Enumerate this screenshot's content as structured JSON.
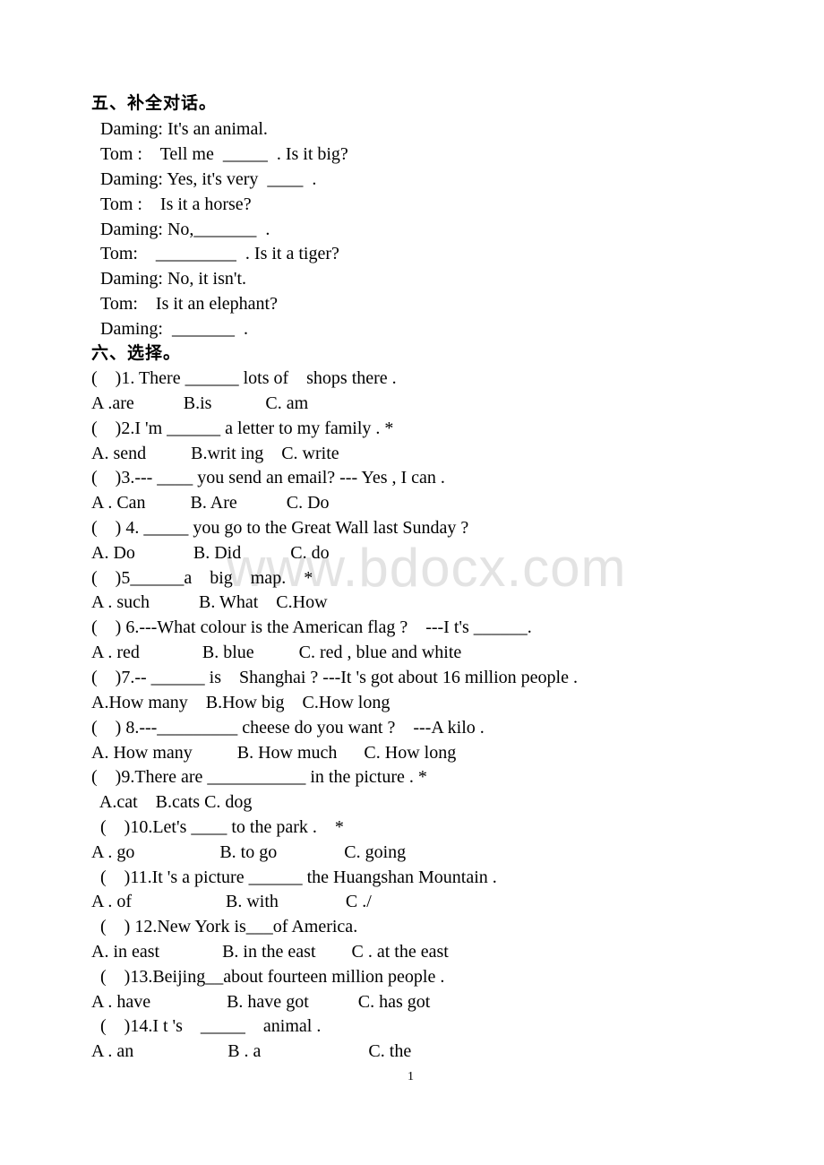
{
  "watermark": "www.bdocx.com",
  "page_number": "1",
  "section5": {
    "heading": "五、补全对话。",
    "lines": [
      "Daming: It's an animal.",
      "Tom :    Tell me  _____  . Is it big?",
      "Daming: Yes, it's very  ____  .",
      "Tom :    Is it a horse?",
      "Daming: No,_______  .",
      "Tom:    _________  . Is it a tiger?",
      "Daming: No, it isn't.",
      "Tom:    Is it an elephant?",
      "Daming:  _______  ."
    ]
  },
  "section6": {
    "heading": "六、选择。",
    "questions": [
      {
        "stem": "(    )1. There ______ lots of    shops there .",
        "options": "A .are           B.is            C. am"
      },
      {
        "stem": "(    )2.I 'm ______ a letter to my family . *",
        "options": "A. send          B.writ ing    C. write"
      },
      {
        "stem": "(    )3.--- ____ you send an email? --- Yes , I can .",
        "options": "A . Can          B. Are           C. Do"
      },
      {
        "stem": "(    ) 4. _____ you go to the Great Wall last Sunday ?",
        "options": "A. Do             B. Did           C. do"
      },
      {
        "stem": "(    )5______a    big    map.    *",
        "options": "A . such           B. What    C.How"
      },
      {
        "stem": "(    ) 6.---What colour is the American flag ?    ---I t's ______.",
        "options": "A . red              B. blue          C. red , blue and white"
      },
      {
        "stem": "(    )7.-- ______ is    Shanghai ? ---It 's got about 16 million people .",
        "options": "A.How many    B.How big    C.How long"
      },
      {
        "stem": "(    ) 8.---_________ cheese do you want ?    ---A kilo .",
        "options": "A. How many          B. How much      C. How long"
      },
      {
        "stem": "(    )9.There are ___________ in the picture . *",
        "options": "  A.cat    B.cats C. dog"
      },
      {
        "stem": "  (    )10.Let's ____ to the park .    *",
        "options": "A . go                   B. to go               C. going"
      },
      {
        "stem": "  (    )11.It 's a picture ______ the Huangshan Mountain .",
        "options": "A . of                     B. with               C ./"
      },
      {
        "stem": "  (    ) 12.New York is___of America.",
        "options": "A. in east              B. in the east        C . at the east"
      },
      {
        "stem": "  (    )13.Beijing__about fourteen million people .",
        "options": "A . have                 B. have got           C. has got"
      },
      {
        "stem": "  (    )14.I t 's    _____    animal .",
        "options": "A . an                     B . a                        C. the"
      }
    ]
  }
}
